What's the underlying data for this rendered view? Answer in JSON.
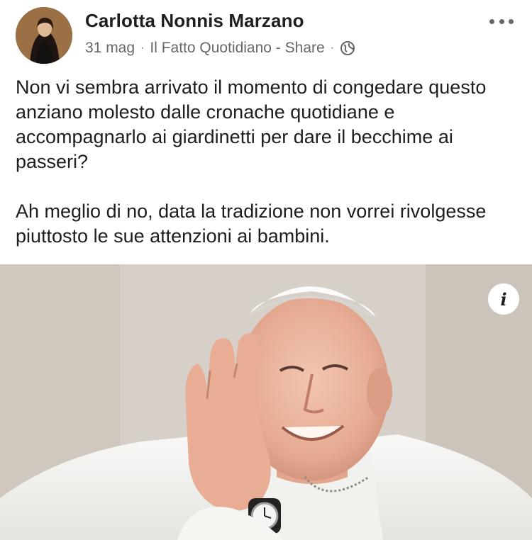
{
  "post": {
    "author": "Carlotta Nonnis Marzano",
    "date": "31 mag",
    "shared_from": "Il Fatto Quotidiano - Share",
    "separator": "·",
    "audience_icon": "globe-icon",
    "more_icon": "more-options-icon",
    "paragraphs": [
      "Non vi sembra arrivato il momento di congedare questo anziano molesto dalle cronache quotidiane e accompagnarlo ai giardinetti per dare il becchime ai passeri?",
      "Ah meglio di no, data la tradizione non vorrei rivolgesse piuttosto le sue attenzioni ai bambini."
    ]
  },
  "photo": {
    "info_label": "i",
    "info_icon": "info-icon"
  },
  "colors": {
    "text": "#1c1e21",
    "secondary": "#65676b",
    "background": "#ffffff"
  }
}
